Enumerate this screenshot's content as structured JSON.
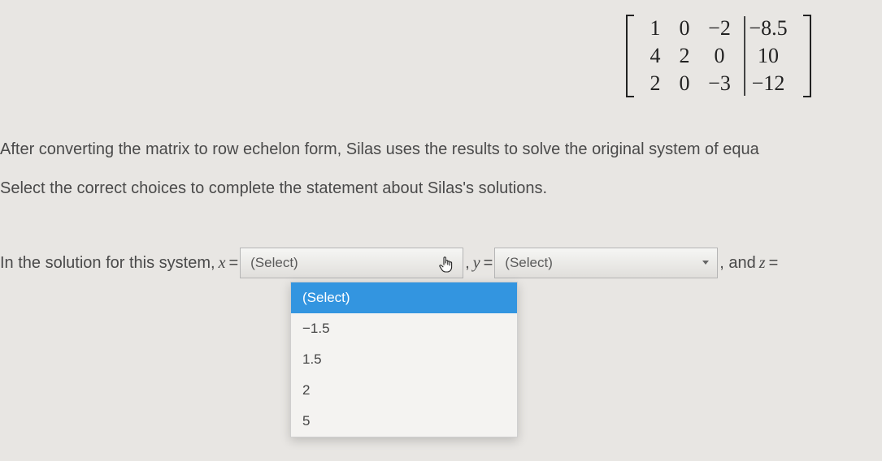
{
  "matrix": {
    "rows": [
      [
        "1",
        "0",
        "−2",
        "−8.5"
      ],
      [
        "4",
        "2",
        "0",
        "10"
      ],
      [
        "2",
        "0",
        "−3",
        "−12"
      ]
    ]
  },
  "question": {
    "line1": "After converting the matrix to row echelon form, Silas uses the results to solve the original system of equa",
    "line2": "Select the correct choices to complete the statement about Silas's solutions."
  },
  "solution": {
    "prefix": "In the solution for this system, ",
    "var_x": "x",
    "eq": " = ",
    "var_y": "y",
    "var_z": "z",
    "comma": " , ",
    "and_z": ", and "
  },
  "select": {
    "placeholder_x": "(Select)",
    "placeholder_y": "(Select)"
  },
  "dropdown": {
    "items": [
      "(Select)",
      "−1.5",
      "1.5",
      "2",
      "5"
    ]
  }
}
